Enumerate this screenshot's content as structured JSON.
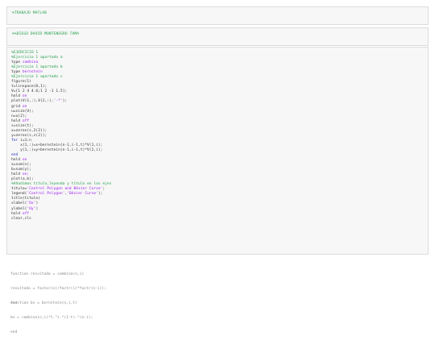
{
  "banners": {
    "title": "%TRABAJO MATLAB",
    "author": "%%DIEGO DAVID MONTENEGRO TAMA"
  },
  "code_lines": [
    [
      {
        "t": "%EJERCICIO 1",
        "c": "c"
      }
    ],
    [
      {
        "t": "%Ejercicio 1 apartado a",
        "c": "c"
      }
    ],
    [
      {
        "t": "type ",
        "c": "plain"
      },
      {
        "t": "combina",
        "c": "s"
      }
    ],
    [
      {
        "t": "%Ejercicio 1 apartado b",
        "c": "c"
      }
    ],
    [
      {
        "t": "type ",
        "c": "plain"
      },
      {
        "t": "bernstein",
        "c": "s"
      }
    ],
    [
      {
        "t": "%Ejercicio 1 apartado c",
        "c": "c"
      }
    ],
    [
      {
        "t": "figure(1)",
        "c": "plain"
      }
    ],
    [
      {
        "t": "t=linspace(0,1);",
        "c": "plain"
      }
    ],
    [
      {
        "t": "V=[1 2 4 4.6;1 2 -1 1.5];",
        "c": "plain"
      }
    ],
    [
      {
        "t": "hold ",
        "c": "plain"
      },
      {
        "t": "on",
        "c": "s"
      }
    ],
    [
      {
        "t": "plot(V(1,:),V(2,:),",
        "c": "plain"
      },
      {
        "t": "'-*'",
        "c": "s"
      },
      {
        "t": ");",
        "c": "plain"
      }
    ],
    [
      {
        "t": "grid ",
        "c": "plain"
      },
      {
        "t": "on",
        "c": "s"
      }
    ],
    [
      {
        "t": "u=size(V);",
        "c": "plain"
      }
    ],
    [
      {
        "t": "n=u(2);",
        "c": "plain"
      }
    ],
    [
      {
        "t": "hold ",
        "c": "plain"
      },
      {
        "t": "off",
        "c": "s"
      }
    ],
    [
      {
        "t": "s=size(t);",
        "c": "plain"
      }
    ],
    [
      {
        "t": "x=zeros(s,2(2));",
        "c": "plain"
      }
    ],
    [
      {
        "t": "y=zeros(s,z(2));",
        "c": "plain"
      }
    ],
    [
      {
        "t": "for ",
        "c": "k"
      },
      {
        "t": "i=1:n",
        "c": "plain"
      }
    ],
    [
      {
        "t": "    x(1,:)=x+bernstein(n-1,i-1,t)*V(1,i);",
        "c": "plain"
      }
    ],
    [
      {
        "t": "    y(1,:)=y+bernstein(n-1,i-1,t)*V(2,i);",
        "c": "plain"
      }
    ],
    [
      {
        "t": "end",
        "c": "k"
      }
    ],
    [
      {
        "t": "hold ",
        "c": "plain"
      },
      {
        "t": "on",
        "c": "s"
      }
    ],
    [
      {
        "t": "x=sum(x);",
        "c": "plain"
      }
    ],
    [
      {
        "t": "b=sum(y);",
        "c": "plain"
      }
    ],
    [
      {
        "t": "hold ",
        "c": "plain"
      },
      {
        "t": "on;",
        "c": "s"
      }
    ],
    [
      {
        "t": "plot(a,b);",
        "c": "plain"
      }
    ],
    [
      {
        "t": "%Añadimos título,leyenda y título en los ejes",
        "c": "c"
      }
    ],
    [
      {
        "t": "titulo=",
        "c": "plain"
      },
      {
        "t": "'Control Polygon and Bézier Curve'",
        "c": "s"
      },
      {
        "t": ";",
        "c": "plain"
      }
    ],
    [
      {
        "t": "legend(",
        "c": "plain"
      },
      {
        "t": "'Control Polygon'",
        "c": "s"
      },
      {
        "t": ",",
        "c": "plain"
      },
      {
        "t": "'Bézier Curve'",
        "c": "s"
      },
      {
        "t": ");",
        "c": "plain"
      }
    ],
    [
      {
        "t": "title(titulo)",
        "c": "plain"
      }
    ],
    [
      {
        "t": "xlabel(",
        "c": "plain"
      },
      {
        "t": "'Ox'",
        "c": "s"
      },
      {
        "t": ")",
        "c": "plain"
      }
    ],
    [
      {
        "t": "ylabel(",
        "c": "plain"
      },
      {
        "t": "'Oy'",
        "c": "s"
      },
      {
        "t": ")",
        "c": "plain"
      }
    ],
    [
      {
        "t": "hold ",
        "c": "plain"
      },
      {
        "t": "off",
        "c": "s"
      }
    ],
    [
      {
        "t": "clear,clc",
        "c": "plain"
      }
    ]
  ],
  "func1": [
    "function resultado = combina(n,i)",
    "resultado = factor(n)/factr(i)*factr(n-i));",
    "end"
  ],
  "func2": [
    "function bs = bernstein(n,i,t)",
    "bs = combina(n,i)*t.^i.*(1-t).^(n-i);",
    "end"
  ]
}
